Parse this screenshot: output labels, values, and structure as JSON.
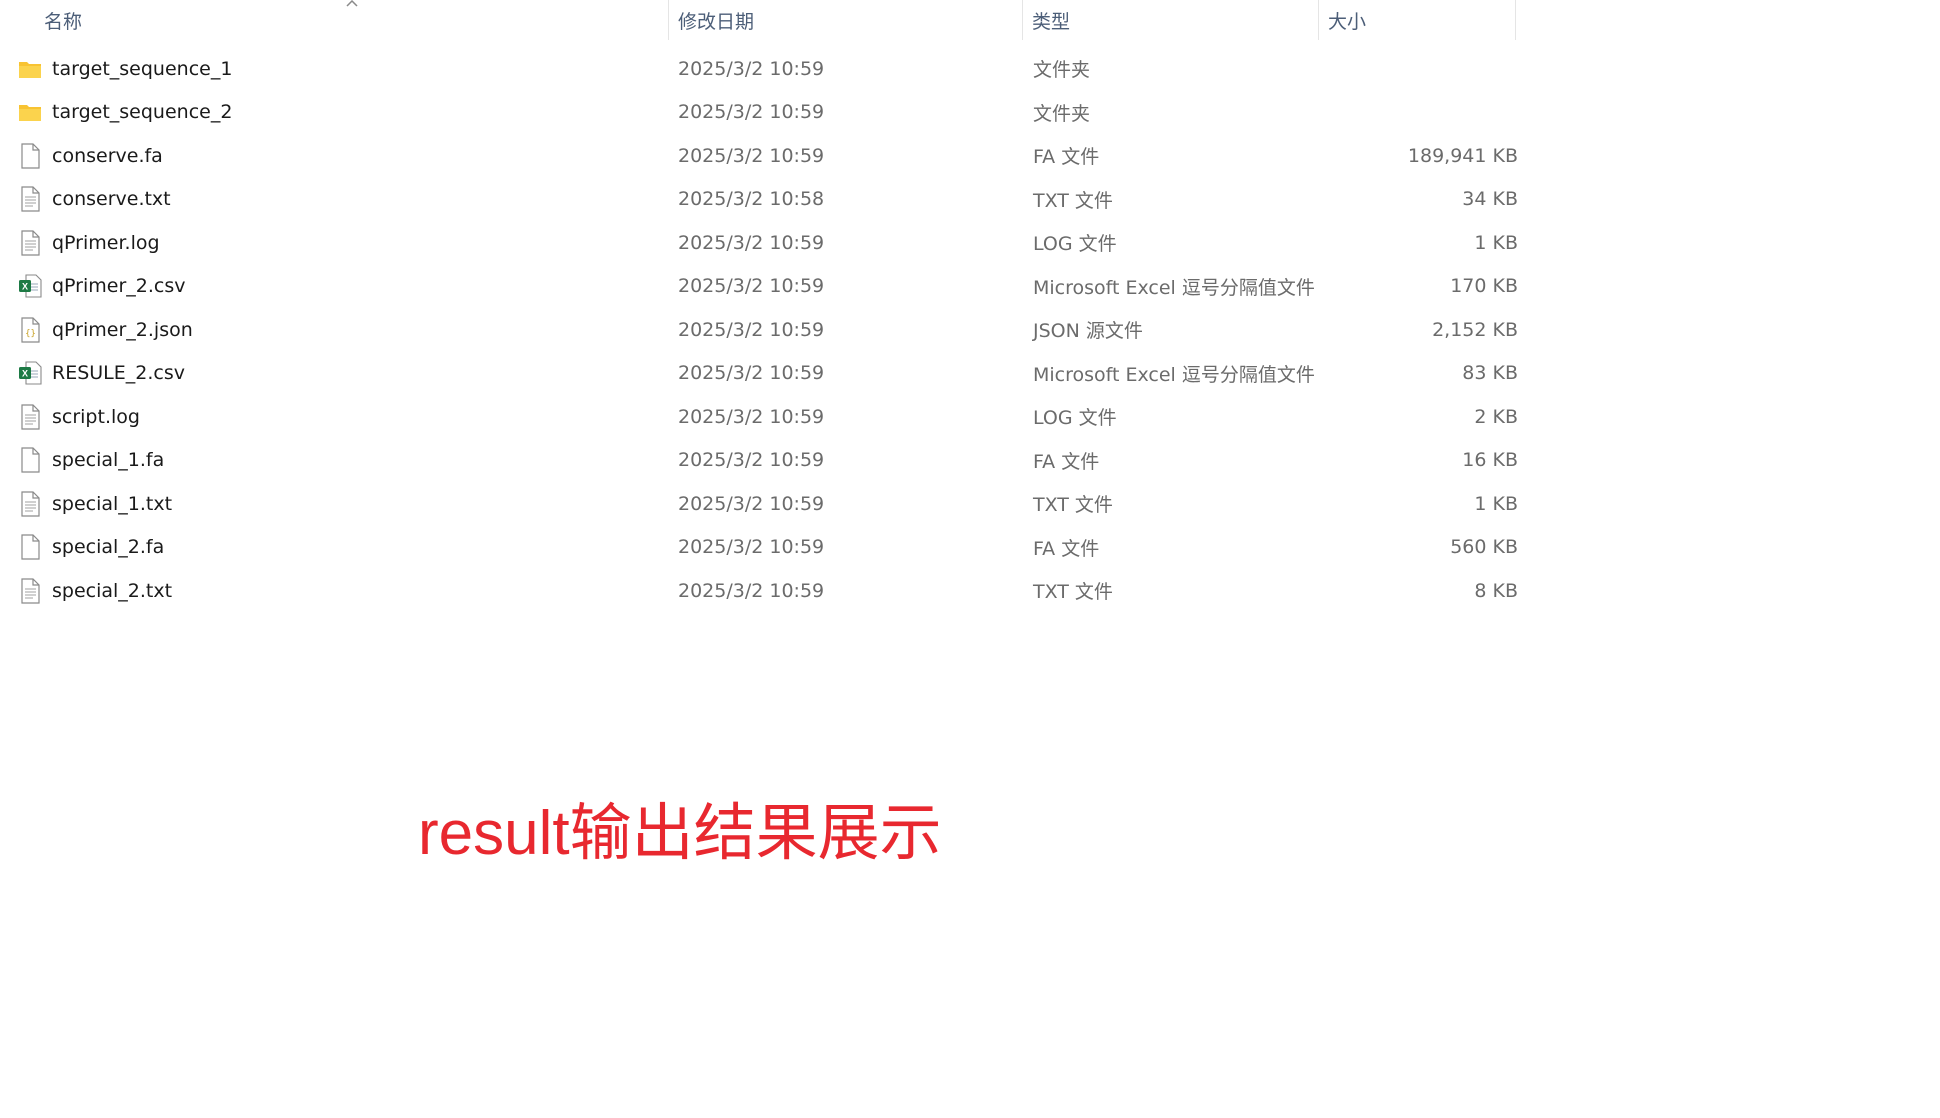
{
  "columns": {
    "name": "名称",
    "date": "修改日期",
    "type": "类型",
    "size": "大小",
    "sort": "ascending"
  },
  "files": [
    {
      "name": "target_sequence_1",
      "date": "2025/3/2 10:59",
      "type": "文件夹",
      "size": "",
      "icon": "folder-icon"
    },
    {
      "name": "target_sequence_2",
      "date": "2025/3/2 10:59",
      "type": "文件夹",
      "size": "",
      "icon": "folder-icon"
    },
    {
      "name": "conserve.fa",
      "date": "2025/3/2 10:59",
      "type": "FA 文件",
      "size": "189,941 KB",
      "icon": "blank-file-icon"
    },
    {
      "name": "conserve.txt",
      "date": "2025/3/2 10:58",
      "type": "TXT 文件",
      "size": "34 KB",
      "icon": "text-file-icon"
    },
    {
      "name": "qPrimer.log",
      "date": "2025/3/2 10:59",
      "type": "LOG 文件",
      "size": "1 KB",
      "icon": "text-file-icon"
    },
    {
      "name": "qPrimer_2.csv",
      "date": "2025/3/2 10:59",
      "type": "Microsoft Excel 逗号分隔值文件",
      "size": "170 KB",
      "icon": "excel-csv-icon"
    },
    {
      "name": "qPrimer_2.json",
      "date": "2025/3/2 10:59",
      "type": "JSON 源文件",
      "size": "2,152 KB",
      "icon": "json-file-icon"
    },
    {
      "name": "RESULE_2.csv",
      "date": "2025/3/2 10:59",
      "type": "Microsoft Excel 逗号分隔值文件",
      "size": "83 KB",
      "icon": "excel-csv-icon"
    },
    {
      "name": "script.log",
      "date": "2025/3/2 10:59",
      "type": "LOG 文件",
      "size": "2 KB",
      "icon": "text-file-icon"
    },
    {
      "name": "special_1.fa",
      "date": "2025/3/2 10:59",
      "type": "FA 文件",
      "size": "16 KB",
      "icon": "blank-file-icon"
    },
    {
      "name": "special_1.txt",
      "date": "2025/3/2 10:59",
      "type": "TXT 文件",
      "size": "1 KB",
      "icon": "text-file-icon"
    },
    {
      "name": "special_2.fa",
      "date": "2025/3/2 10:59",
      "type": "FA 文件",
      "size": "560 KB",
      "icon": "blank-file-icon"
    },
    {
      "name": "special_2.txt",
      "date": "2025/3/2 10:59",
      "type": "TXT 文件",
      "size": "8 KB",
      "icon": "text-file-icon"
    }
  ],
  "caption": "result输出结果展示",
  "colors": {
    "header_text": "#4c5e78",
    "caption": "#e8282f",
    "folder": "#f8c332",
    "excel_green": "#1d7a45"
  }
}
